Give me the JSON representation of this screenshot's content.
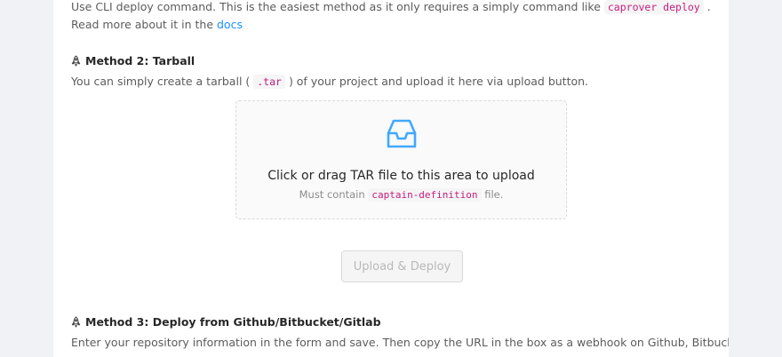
{
  "method1": {
    "text_before": "Use CLI deploy command. This is the easiest method as it only requires a simply command like",
    "command": "caprover deploy",
    "text_after": ". Read more about it in the",
    "docs_link": "docs"
  },
  "method2": {
    "title": "Method 2: Tarball",
    "desc_before": "You can simply create a tarball (",
    "desc_code": ".tar",
    "desc_after": ") of your project and upload it here via upload button.",
    "dropzone": {
      "icon": "inbox-icon",
      "main_text": "Click or drag TAR file to this area to upload",
      "hint_before": "Must contain",
      "hint_code": "captain-definition",
      "hint_after": "file."
    },
    "upload_button_label": "Upload & Deploy",
    "upload_button_disabled": true
  },
  "method3": {
    "title": "Method 3: Deploy from Github/Bitbucket/Gitlab",
    "desc": "Enter your repository information in the form and save. Then copy the URL in the box as a webhook on Github, Bitbucket, Gitlab and"
  },
  "colors": {
    "accent": "#1890ff",
    "code_text": "#c41d7f",
    "code_bg": "#f5f5f5",
    "page_bg": "#f0f2f5"
  },
  "icons": {
    "method_title": "rocket-icon",
    "dropzone": "inbox-icon"
  }
}
